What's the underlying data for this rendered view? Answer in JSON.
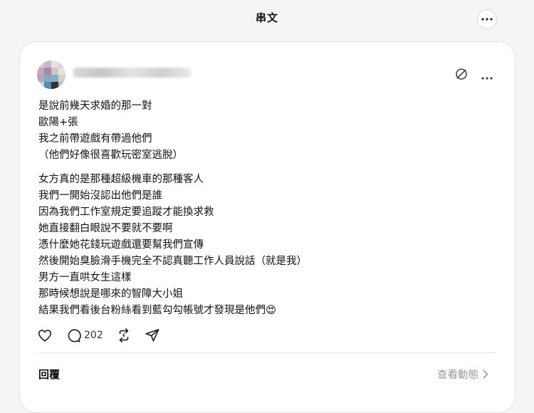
{
  "header": {
    "title": "串文"
  },
  "post": {
    "paragraphs": [
      [
        "是說前幾天求婚的那一對",
        "歐陽+張",
        "我之前帶遊戲有帶過他們",
        "（他們好像很喜歡玩密室逃脫）"
      ],
      [
        "女方真的是那種超級機車的那種客人",
        "我們一開始沒認出他們是誰",
        "因為我們工作室規定要追蹤才能換求救",
        "她直接翻白眼說不要就不要啊",
        "憑什麼她花錢玩遊戲還要幫我們宣傳",
        "然後開始臭臉滑手機完全不認真聽工作人員說話（就是我）",
        "男方一直哄女生這樣",
        "那時候想說是哪來的智障大小姐",
        "結果我們看後台粉絲看到藍勾勾帳號才發現是他們😍"
      ]
    ],
    "reply_count": "202",
    "icons": {
      "header_more": "more-horizontal-icon",
      "mute": "mute-icon",
      "post_more": "more-horizontal-icon",
      "like": "heart-icon",
      "comment": "comment-icon",
      "repost": "repost-icon",
      "share": "share-icon",
      "chevron": "chevron-right-icon"
    }
  },
  "replies": {
    "label": "回覆",
    "activity_link": "查看動態"
  },
  "colors": {
    "background": "#f5f5f5",
    "card": "#ffffff",
    "text": "#111111",
    "muted": "#999999",
    "border": "#e3e3e3"
  }
}
